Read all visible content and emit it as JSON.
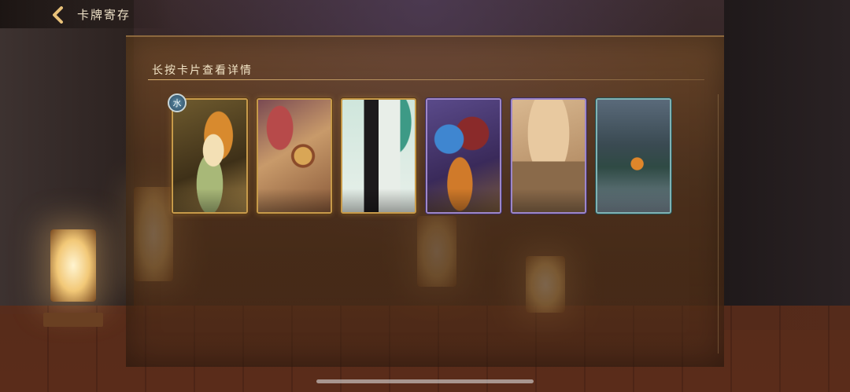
{
  "header": {
    "title": "卡牌寄存",
    "back_icon": "chevron-left-icon"
  },
  "panel": {
    "hint": "长按卡片查看详情"
  },
  "cards": [
    {
      "frame": "gold",
      "badge": "水"
    },
    {
      "frame": "gold"
    },
    {
      "frame": "gold"
    },
    {
      "frame": "purple"
    },
    {
      "frame": "purple"
    },
    {
      "frame": "teal"
    }
  ],
  "colors": {
    "gold_frame": "#c79a4a",
    "purple_frame": "#9d86c9",
    "teal_frame": "#7fb2b3",
    "text": "#efe2c8"
  }
}
